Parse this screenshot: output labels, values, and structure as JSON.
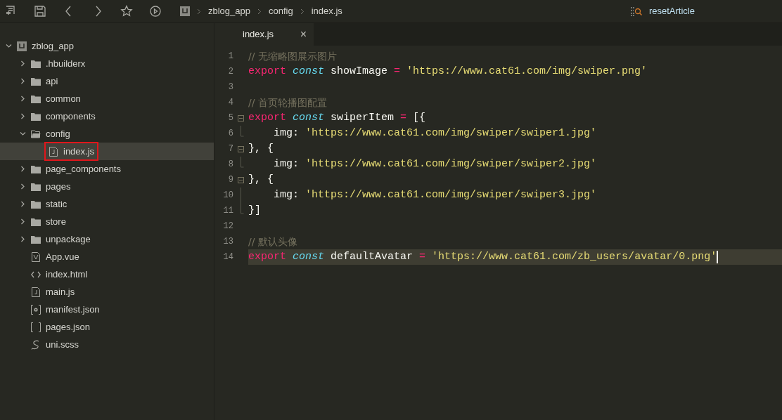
{
  "toolbar": {
    "breadcrumb": [
      "zblog_app",
      "config",
      "index.js"
    ],
    "search": "resetArticle"
  },
  "tree": [
    {
      "label": "zblog_app",
      "kind": "project",
      "expanded": true,
      "selected": false,
      "children": [
        {
          "label": ".hbuilderx",
          "kind": "folder",
          "expanded": false,
          "selected": false
        },
        {
          "label": "api",
          "kind": "folder",
          "expanded": false,
          "selected": false
        },
        {
          "label": "common",
          "kind": "folder",
          "expanded": false,
          "selected": false
        },
        {
          "label": "components",
          "kind": "folder",
          "expanded": false,
          "selected": false
        },
        {
          "label": "config",
          "kind": "folder",
          "expanded": true,
          "selected": false,
          "children": [
            {
              "label": "index.js",
              "kind": "js",
              "selected": true,
              "boxed": true
            }
          ]
        },
        {
          "label": "page_components",
          "kind": "folder",
          "expanded": false,
          "selected": false
        },
        {
          "label": "pages",
          "kind": "folder",
          "expanded": false,
          "selected": false
        },
        {
          "label": "static",
          "kind": "folder",
          "expanded": false,
          "selected": false
        },
        {
          "label": "store",
          "kind": "folder",
          "expanded": false,
          "selected": false
        },
        {
          "label": "unpackage",
          "kind": "folder",
          "expanded": false,
          "selected": false
        },
        {
          "label": "App.vue",
          "kind": "vue",
          "selected": false
        },
        {
          "label": "index.html",
          "kind": "html",
          "selected": false
        },
        {
          "label": "main.js",
          "kind": "js",
          "selected": false
        },
        {
          "label": "manifest.json",
          "kind": "manifest",
          "selected": false
        },
        {
          "label": "pages.json",
          "kind": "brackets",
          "selected": false
        },
        {
          "label": "uni.scss",
          "kind": "style",
          "selected": false
        }
      ]
    }
  ],
  "tabs": [
    {
      "label": "index.js",
      "selected": true,
      "close": "×"
    }
  ],
  "code": [
    {
      "number": "1",
      "tokens": [
        {
          "kind": "comment",
          "text": "// 无缩略图展示图片"
        }
      ]
    },
    {
      "number": "2",
      "tokens": [
        {
          "kind": "keyword",
          "text": "export "
        },
        {
          "kind": "storage",
          "text": "const "
        },
        {
          "kind": "plain",
          "text": "showImage "
        },
        {
          "kind": "keyword",
          "text": "= "
        },
        {
          "kind": "string",
          "text": "'https://www.cat61.com/img/swiper.png'"
        }
      ]
    },
    {
      "number": "3"
    },
    {
      "number": "4",
      "tokens": [
        {
          "kind": "comment",
          "text": "// 首页轮播图配置"
        }
      ]
    },
    {
      "number": "5",
      "fold_start": true,
      "tokens": [
        {
          "kind": "keyword",
          "text": "export "
        },
        {
          "kind": "storage",
          "text": "const "
        },
        {
          "kind": "plain",
          "text": "swiperItem "
        },
        {
          "kind": "keyword",
          "text": "= "
        },
        {
          "kind": "plain",
          "text": "[{"
        }
      ]
    },
    {
      "number": "6",
      "fold_end": true,
      "tokens": [
        {
          "kind": "plain",
          "text": "    img: "
        },
        {
          "kind": "string",
          "text": "'https://www.cat61.com/img/swiper/swiper1.jpg'"
        }
      ]
    },
    {
      "number": "7",
      "fold_start": true,
      "tokens": [
        {
          "kind": "plain",
          "text": "}, {"
        }
      ]
    },
    {
      "number": "8",
      "fold_end": true,
      "tokens": [
        {
          "kind": "plain",
          "text": "    img: "
        },
        {
          "kind": "string",
          "text": "'https://www.cat61.com/img/swiper/swiper2.jpg'"
        }
      ]
    },
    {
      "number": "9",
      "fold_start": true,
      "tokens": [
        {
          "kind": "plain",
          "text": "}, {"
        }
      ]
    },
    {
      "number": "10",
      "fold_guide": true,
      "tokens": [
        {
          "kind": "plain",
          "text": "    img: "
        },
        {
          "kind": "string",
          "text": "'https://www.cat61.com/img/swiper/swiper3.jpg'"
        }
      ]
    },
    {
      "number": "11",
      "fold_end": true,
      "tokens": [
        {
          "kind": "plain",
          "text": "}]"
        }
      ]
    },
    {
      "number": "12"
    },
    {
      "number": "13",
      "tokens": [
        {
          "kind": "comment",
          "text": "// 默认头像"
        }
      ]
    },
    {
      "number": "14",
      "current": true,
      "tokens": [
        {
          "kind": "keyword",
          "text": "export "
        },
        {
          "kind": "storage",
          "text": "const "
        },
        {
          "kind": "plain",
          "text": "defaultAvatar "
        },
        {
          "kind": "keyword",
          "text": "= "
        },
        {
          "kind": "string",
          "text": "'https://www.cat61.com/zb_users/avatar/0.png'"
        }
      ]
    }
  ]
}
